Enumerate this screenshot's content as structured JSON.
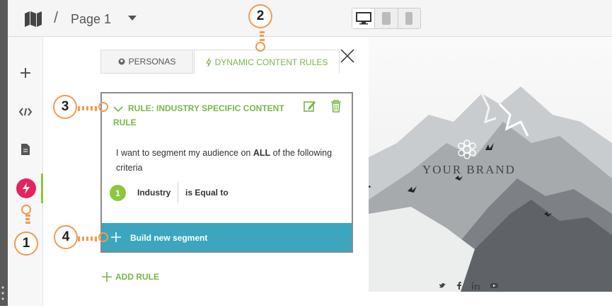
{
  "header": {
    "breadcrumb_sep": "/",
    "page_title": "Page 1"
  },
  "tabs": {
    "personas": "PERSONAS",
    "dynamic": "DYNAMIC CONTENT RULES"
  },
  "rule": {
    "title": "RULE: INDUSTRY SPECIFIC CONTENT RULE",
    "desc_prefix": "I want to segment my audience on ",
    "desc_bold": "ALL",
    "desc_suffix": " of the following criteria",
    "criterion_number": "1",
    "criterion_field": "Industry",
    "criterion_operator": "is Equal to",
    "build_label": "Build new segment"
  },
  "add_rule_label": "ADD RULE",
  "preview": {
    "brand": "YOUR BRAND",
    "social": [
      "twitter-icon",
      "facebook-icon",
      "linkedin-icon",
      "youtube-icon"
    ]
  },
  "callouts": [
    "1",
    "2",
    "3",
    "4"
  ],
  "colors": {
    "accent_green": "#7ab648",
    "segment_blue": "#3ba6be",
    "lightning_pink": "#e3245f",
    "callout_orange": "#f39a4d"
  }
}
